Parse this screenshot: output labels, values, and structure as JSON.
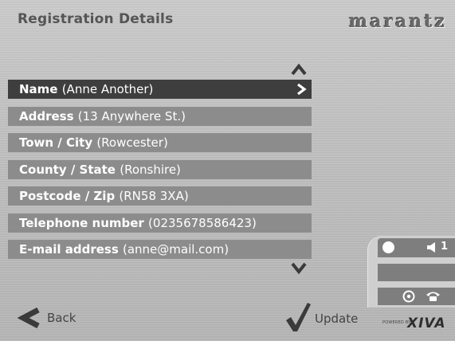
{
  "header": {
    "title": "Registration Details",
    "brand": "marantz"
  },
  "fields": [
    {
      "label": "Name",
      "value": "(Anne Another)",
      "selected": true
    },
    {
      "label": "Address",
      "value": "(13 Anywhere St.)"
    },
    {
      "label": "Town / City",
      "value": "(Rowcester)"
    },
    {
      "label": "County / State",
      "value": "(Ronshire)"
    },
    {
      "label": "Postcode / Zip",
      "value": "(RN58 3XA)"
    },
    {
      "label": "Telephone number",
      "value": "(0235678586423)"
    },
    {
      "label": "E-mail address",
      "value": "(anne@mail.com)"
    }
  ],
  "status_panel": {
    "volume": "1"
  },
  "footer": {
    "back_label": "Back",
    "update_label": "Update",
    "powered_by": "POWERED BY",
    "powered_logo": "XIVA"
  },
  "colors": {
    "row": "#8c8c8c",
    "row_selected": "#3e3e3e",
    "background": "#bdbdbd"
  },
  "icons": [
    "scroll-up-icon",
    "scroll-down-icon",
    "select-arrow-icon",
    "record-dot-icon",
    "speaker-icon",
    "disc-icon",
    "phone-icon",
    "back-arrow-icon",
    "checkmark-icon"
  ]
}
